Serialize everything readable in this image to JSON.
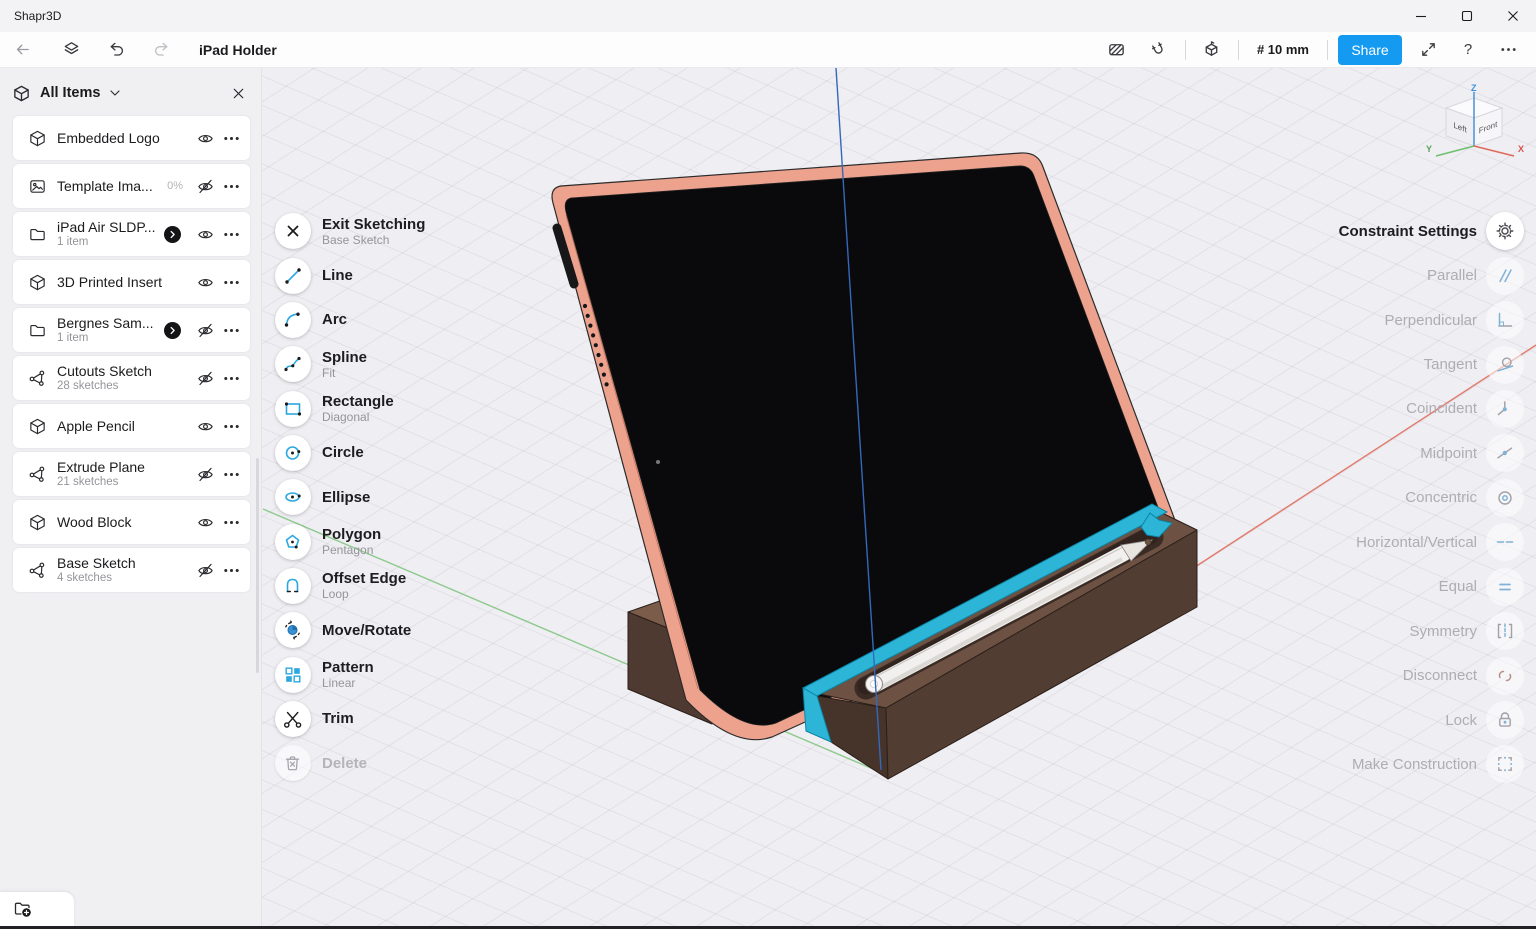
{
  "app": {
    "title": "Shapr3D"
  },
  "toolbar": {
    "document_title": "iPad Holder",
    "grid_size": "# 10 mm",
    "share_label": "Share",
    "help_label": "?"
  },
  "sidebar": {
    "title": "All Items",
    "items": [
      {
        "name": "Embedded Logo",
        "sub": "",
        "meta": "",
        "icon": "cube-icon",
        "visibility": "eye-icon"
      },
      {
        "name": "Template Ima...",
        "sub": "",
        "meta": "0%",
        "icon": "image-icon",
        "visibility": "eye-off-icon"
      },
      {
        "name": "iPad Air SLDP...",
        "sub": "1 item",
        "meta": "",
        "icon": "folder-icon",
        "visibility": "eye-icon",
        "badge": "chevron-right-icon"
      },
      {
        "name": "3D Printed Insert",
        "sub": "",
        "meta": "",
        "icon": "cube-icon",
        "visibility": "eye-icon"
      },
      {
        "name": "Bergnes Sam...",
        "sub": "1 item",
        "meta": "",
        "icon": "folder-icon",
        "visibility": "eye-off-icon",
        "badge": "chevron-right-icon"
      },
      {
        "name": "Cutouts Sketch",
        "sub": "28 sketches",
        "meta": "",
        "icon": "sketch-icon",
        "visibility": "eye-off-icon"
      },
      {
        "name": "Apple Pencil",
        "sub": "",
        "meta": "",
        "icon": "cube-icon",
        "visibility": "eye-icon"
      },
      {
        "name": "Extrude Plane",
        "sub": "21 sketches",
        "meta": "",
        "icon": "sketch-icon",
        "visibility": "eye-off-icon"
      },
      {
        "name": "Wood Block",
        "sub": "",
        "meta": "",
        "icon": "cube-icon",
        "visibility": "eye-icon"
      },
      {
        "name": "Base Sketch",
        "sub": "4 sketches",
        "meta": "",
        "icon": "sketch-icon",
        "visibility": "eye-off-icon"
      }
    ]
  },
  "tools": {
    "items": [
      {
        "label": "Exit Sketching",
        "sub": "Base Sketch"
      },
      {
        "label": "Line"
      },
      {
        "label": "Arc"
      },
      {
        "label": "Spline",
        "sub": "Fit"
      },
      {
        "label": "Rectangle",
        "sub": "Diagonal"
      },
      {
        "label": "Circle"
      },
      {
        "label": "Ellipse"
      },
      {
        "label": "Polygon",
        "sub": "Pentagon"
      },
      {
        "label": "Offset Edge",
        "sub": "Loop"
      },
      {
        "label": "Move/Rotate"
      },
      {
        "label": "Pattern",
        "sub": "Linear"
      },
      {
        "label": "Trim"
      },
      {
        "label": "Delete",
        "disabled": true
      }
    ]
  },
  "constraints": {
    "title": "Constraint Settings",
    "items": [
      "Parallel",
      "Perpendicular",
      "Tangent",
      "Coincident",
      "Midpoint",
      "Concentric",
      "Horizontal/Vertical",
      "Equal",
      "Symmetry",
      "Disconnect",
      "Lock",
      "Make Construction"
    ]
  },
  "viewcube": {
    "z": "Z",
    "y": "Y",
    "x": "X",
    "left": "Left",
    "front": "Front"
  },
  "colors": {
    "accent_blue": "#149af1",
    "highlight_teal": "#2cb5d6",
    "ipad_frame": "#eda28e",
    "stand_top": "#6d5143",
    "stand_front": "#523d33",
    "axis_x_red": "#e2796a",
    "axis_y_green": "#8cc98c",
    "axis_z_blue": "#3468bb"
  }
}
